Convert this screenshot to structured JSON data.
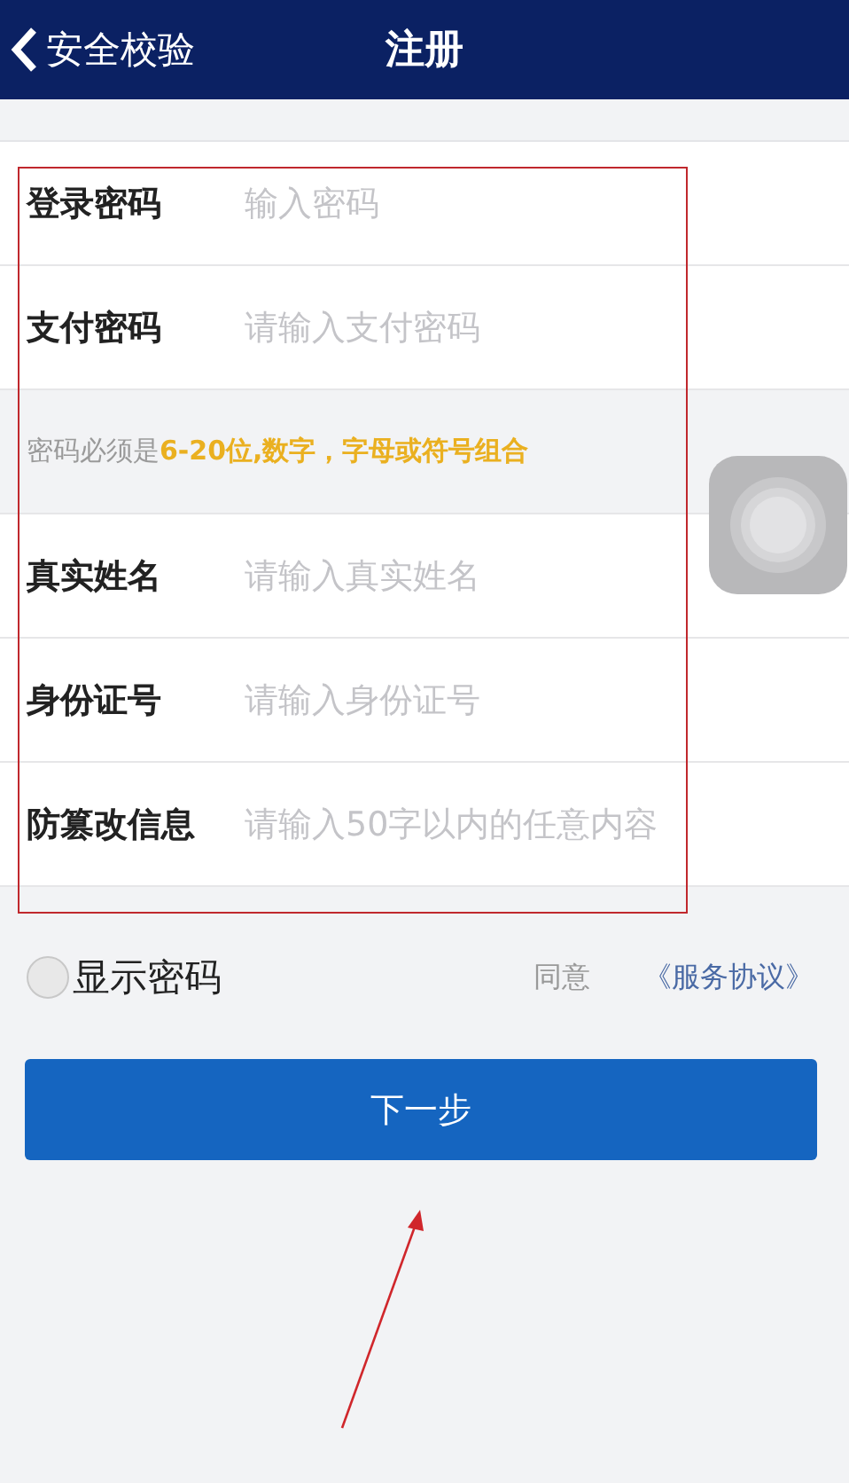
{
  "header": {
    "back_label": "安全校验",
    "title": "注册"
  },
  "fields_top": [
    {
      "label": "登录密码",
      "placeholder": "输入密码"
    },
    {
      "label": "支付密码",
      "placeholder": "请输入支付密码"
    }
  ],
  "hint": {
    "text": "密码必须是",
    "highlight": "6-20位,数字，字母或符号组合"
  },
  "fields_bottom": [
    {
      "label": "真实姓名",
      "placeholder": "请输入真实姓名"
    },
    {
      "label": "身份证号",
      "placeholder": "请输入身份证号"
    },
    {
      "label": "防篡改信息",
      "placeholder": "请输入50字以内的任意内容"
    }
  ],
  "show_password": {
    "label": "显示密码",
    "checked": false
  },
  "agreement": {
    "prefix": "同意",
    "link": "《服务协议》"
  },
  "next_button": "下一步"
}
